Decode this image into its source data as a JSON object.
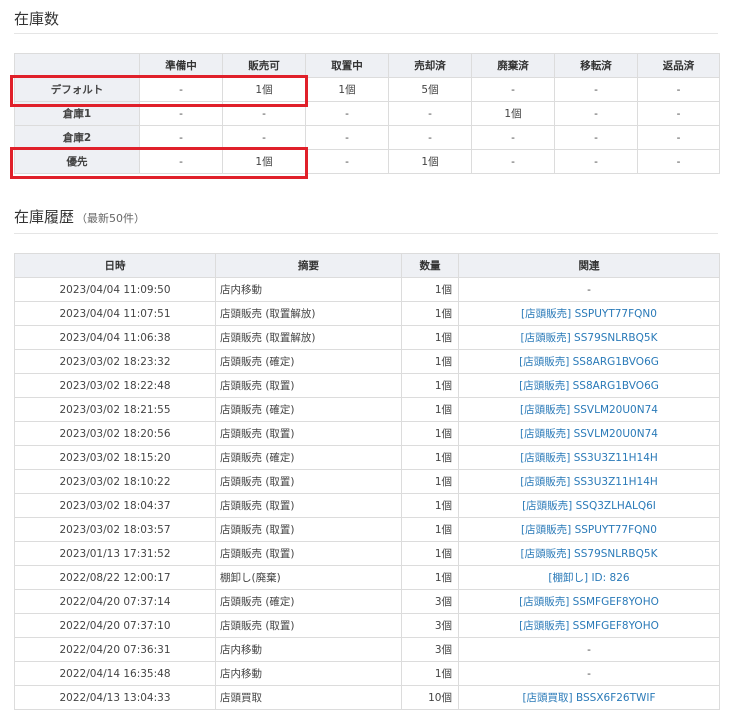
{
  "stock": {
    "title": "在庫数",
    "columns": [
      "",
      "準備中",
      "販売可",
      "取置中",
      "売却済",
      "廃棄済",
      "移転済",
      "返品済"
    ],
    "rows": [
      {
        "label": "デフォルト",
        "cells": [
          "-",
          "1個",
          "1個",
          "5個",
          "-",
          "-",
          "-"
        ]
      },
      {
        "label": "倉庫1",
        "cells": [
          "-",
          "-",
          "-",
          "-",
          "1個",
          "-",
          "-"
        ]
      },
      {
        "label": "倉庫2",
        "cells": [
          "-",
          "-",
          "-",
          "-",
          "-",
          "-",
          "-"
        ]
      },
      {
        "label": "優先",
        "cells": [
          "-",
          "1個",
          "-",
          "1個",
          "-",
          "-",
          "-"
        ]
      }
    ]
  },
  "history": {
    "title": "在庫履歴",
    "subtitle": "（最新50件）",
    "columns": [
      "日時",
      "摘要",
      "数量",
      "関連"
    ],
    "rows": [
      {
        "date": "2023/04/04 11:09:50",
        "summary": "店内移動",
        "qty": "1個",
        "related": "-"
      },
      {
        "date": "2023/04/04 11:07:51",
        "summary": "店頭販売 (取置解放)",
        "qty": "1個",
        "related": "[店頭販売] SSPUYT77FQN0"
      },
      {
        "date": "2023/04/04 11:06:38",
        "summary": "店頭販売 (取置解放)",
        "qty": "1個",
        "related": "[店頭販売] SS79SNLRBQ5K"
      },
      {
        "date": "2023/03/02 18:23:32",
        "summary": "店頭販売 (確定)",
        "qty": "1個",
        "related": "[店頭販売] SS8ARG1BVO6G"
      },
      {
        "date": "2023/03/02 18:22:48",
        "summary": "店頭販売 (取置)",
        "qty": "1個",
        "related": "[店頭販売] SS8ARG1BVO6G"
      },
      {
        "date": "2023/03/02 18:21:55",
        "summary": "店頭販売 (確定)",
        "qty": "1個",
        "related": "[店頭販売] SSVLM20U0N74"
      },
      {
        "date": "2023/03/02 18:20:56",
        "summary": "店頭販売 (取置)",
        "qty": "1個",
        "related": "[店頭販売] SSVLM20U0N74"
      },
      {
        "date": "2023/03/02 18:15:20",
        "summary": "店頭販売 (確定)",
        "qty": "1個",
        "related": "[店頭販売] SS3U3Z11H14H"
      },
      {
        "date": "2023/03/02 18:10:22",
        "summary": "店頭販売 (取置)",
        "qty": "1個",
        "related": "[店頭販売] SS3U3Z11H14H"
      },
      {
        "date": "2023/03/02 18:04:37",
        "summary": "店頭販売 (取置)",
        "qty": "1個",
        "related": "[店頭販売] SSQ3ZLHALQ6I"
      },
      {
        "date": "2023/03/02 18:03:57",
        "summary": "店頭販売 (取置)",
        "qty": "1個",
        "related": "[店頭販売] SSPUYT77FQN0"
      },
      {
        "date": "2023/01/13 17:31:52",
        "summary": "店頭販売 (取置)",
        "qty": "1個",
        "related": "[店頭販売] SS79SNLRBQ5K"
      },
      {
        "date": "2022/08/22 12:00:17",
        "summary": "棚卸し(廃棄)",
        "qty": "1個",
        "related": "[棚卸し] ID: 826"
      },
      {
        "date": "2022/04/20 07:37:14",
        "summary": "店頭販売 (確定)",
        "qty": "3個",
        "related": "[店頭販売] SSMFGEF8YOHO"
      },
      {
        "date": "2022/04/20 07:37:10",
        "summary": "店頭販売 (取置)",
        "qty": "3個",
        "related": "[店頭販売] SSMFGEF8YOHO"
      },
      {
        "date": "2022/04/20 07:36:31",
        "summary": "店内移動",
        "qty": "3個",
        "related": "-"
      },
      {
        "date": "2022/04/14 16:35:48",
        "summary": "店内移動",
        "qty": "1個",
        "related": "-"
      },
      {
        "date": "2022/04/13 13:04:33",
        "summary": "店頭買取",
        "qty": "10個",
        "related": "[店頭買取] BSSX6F26TWIF"
      }
    ]
  },
  "colors": {
    "header_bg": "#eef0f4",
    "border": "#dcdcdc",
    "link": "#2a7ab8",
    "highlight": "#e0202a"
  }
}
